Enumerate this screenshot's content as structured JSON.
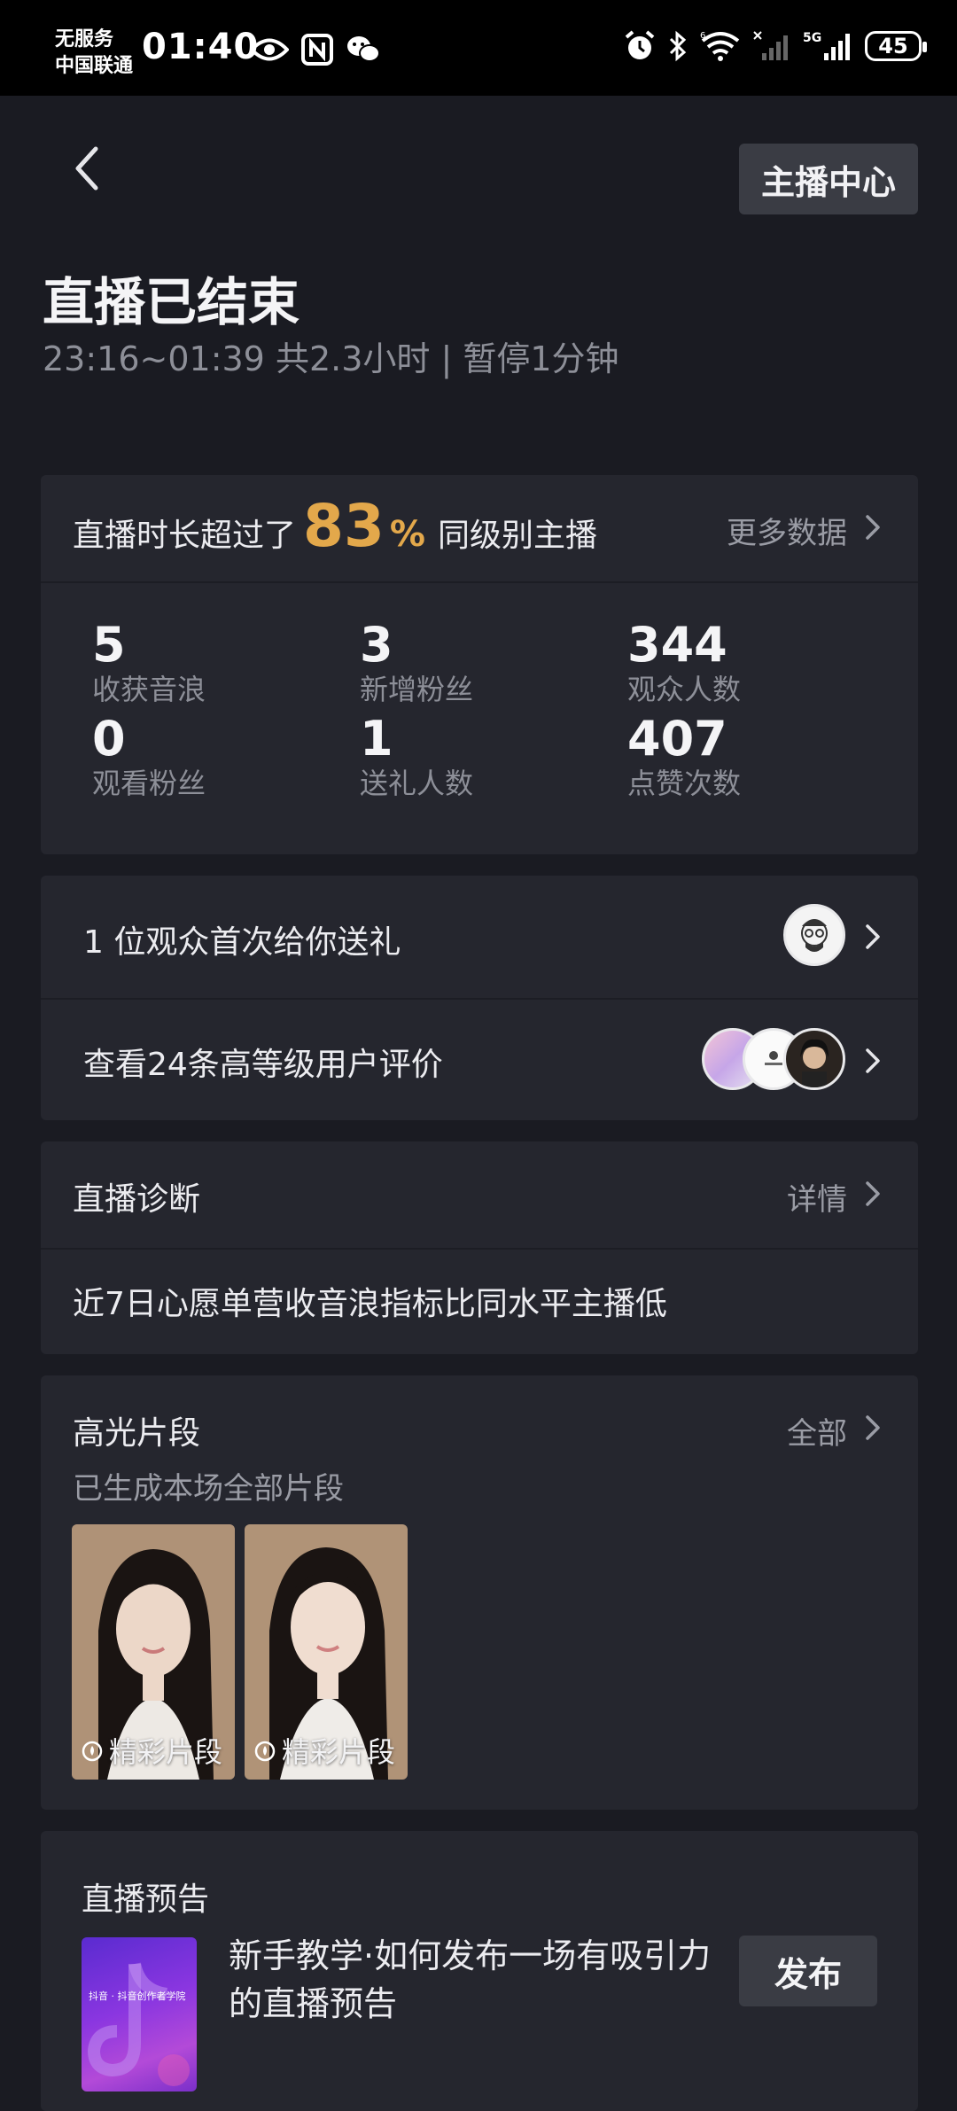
{
  "status_bar": {
    "carrier_line1": "无服务",
    "carrier_line2": "中国联通",
    "time": "01:40",
    "signal_label": "5G",
    "wifi_label": "6",
    "battery": "45"
  },
  "header": {
    "center_button": "主播中心",
    "title": "直播已结束",
    "subtitle": "23:16~01:39 共2.3小时 | 暂停1分钟"
  },
  "summary": {
    "rank_prefix": "直播时长超过了",
    "rank_value": "83",
    "rank_unit": "%",
    "rank_suffix": "同级别主播",
    "more_label": "更多数据",
    "stats": [
      {
        "value": "5",
        "label": "收获音浪"
      },
      {
        "value": "3",
        "label": "新增粉丝"
      },
      {
        "value": "344",
        "label": "观众人数"
      },
      {
        "value": "0",
        "label": "观看粉丝"
      },
      {
        "value": "1",
        "label": "送礼人数"
      },
      {
        "value": "407",
        "label": "点赞次数"
      }
    ]
  },
  "audience": {
    "first_gift_text": "1 位观众首次给你送礼",
    "reviews_text": "查看24条高等级用户评价"
  },
  "diagnosis": {
    "title": "直播诊断",
    "link": "详情",
    "message": "近7日心愿单营收音浪指标比同水平主播低"
  },
  "highlights": {
    "title": "高光片段",
    "link": "全部",
    "subtitle": "已生成本场全部片段",
    "clips": [
      {
        "label": "精彩片段"
      },
      {
        "label": "精彩片段"
      }
    ]
  },
  "preview": {
    "title": "直播预告",
    "image_caption": "抖音 · 抖音创作者学院",
    "text": "新手教学·如何发布一场有吸引力的直播预告",
    "button": "发布"
  },
  "colors": {
    "background": "#1a1b22",
    "card": "#25262e",
    "accent": "#e3a84b"
  }
}
